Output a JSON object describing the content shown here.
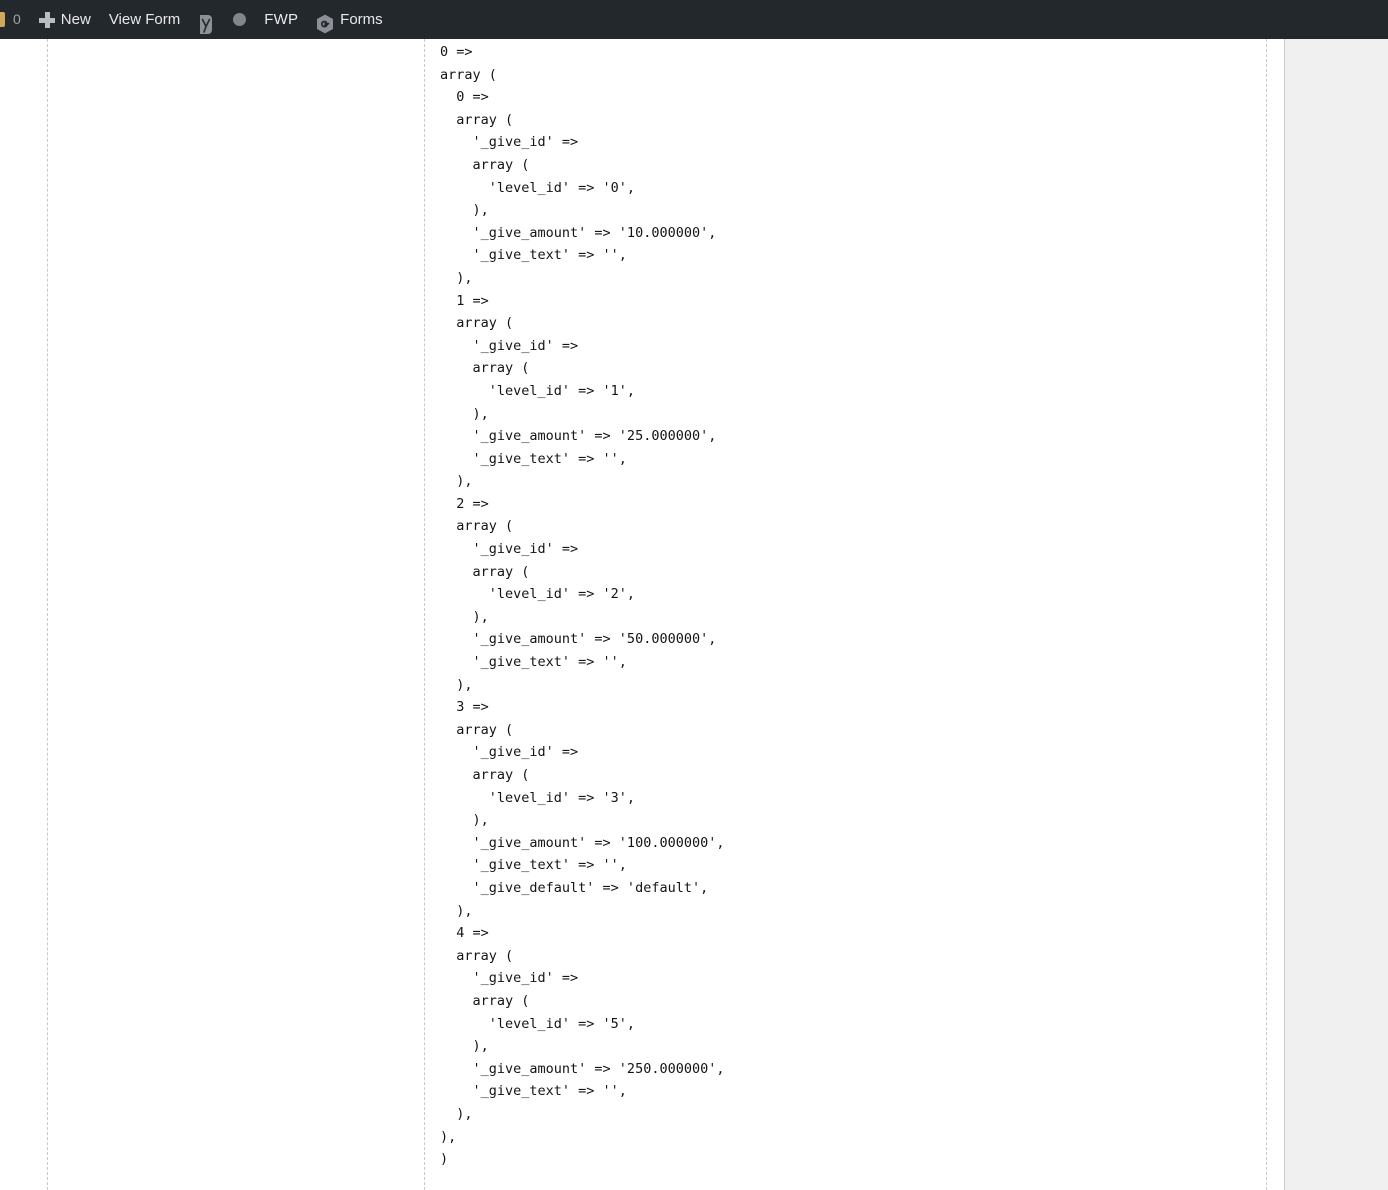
{
  "adminbar": {
    "background": "#23282d",
    "items": [
      {
        "name": "comment-bubble-icon",
        "icon": "comment-bubble-icon",
        "label": "",
        "count": "0"
      },
      {
        "name": "new-content",
        "icon": "plus-icon",
        "label": "New"
      },
      {
        "name": "view-form",
        "icon": "",
        "label": "View Form"
      },
      {
        "name": "yoast-seo",
        "icon": "yoast-icon",
        "label": ""
      },
      {
        "name": "circle-status",
        "icon": "circle-icon",
        "label": ""
      },
      {
        "name": "fwp",
        "icon": "",
        "label": "FWP"
      },
      {
        "name": "givewp-forms",
        "icon": "givewp-hexagon-icon",
        "label": "Forms"
      }
    ],
    "comment_count": "0",
    "new_label": "New",
    "view_form_label": "View Form",
    "fwp_label": "FWP",
    "forms_label": "Forms"
  },
  "code_dump": {
    "language": "php-var-export",
    "text": "0 => \narray (\n  0 => \n  array (\n    '_give_id' => \n    array (\n      'level_id' => '0',\n    ),\n    '_give_amount' => '10.000000',\n    '_give_text' => '',\n  ),\n  1 => \n  array (\n    '_give_id' => \n    array (\n      'level_id' => '1',\n    ),\n    '_give_amount' => '25.000000',\n    '_give_text' => '',\n  ),\n  2 => \n  array (\n    '_give_id' => \n    array (\n      'level_id' => '2',\n    ),\n    '_give_amount' => '50.000000',\n    '_give_text' => '',\n  ),\n  3 => \n  array (\n    '_give_id' => \n    array (\n      'level_id' => '3',\n    ),\n    '_give_amount' => '100.000000',\n    '_give_text' => '',\n    '_give_default' => 'default',\n  ),\n  4 => \n  array (\n    '_give_id' => \n    array (\n      'level_id' => '5',\n    ),\n    '_give_amount' => '250.000000',\n    '_give_text' => '',\n  ),\n),\n)",
    "levels": [
      {
        "index": "0",
        "level_id": "0",
        "give_amount": "10.000000",
        "give_text": "",
        "give_default": null
      },
      {
        "index": "1",
        "level_id": "1",
        "give_amount": "25.000000",
        "give_text": "",
        "give_default": null
      },
      {
        "index": "2",
        "level_id": "2",
        "give_amount": "50.000000",
        "give_text": "",
        "give_default": null
      },
      {
        "index": "3",
        "level_id": "3",
        "give_amount": "100.000000",
        "give_text": "",
        "give_default": "default"
      },
      {
        "index": "4",
        "level_id": "5",
        "give_amount": "250.000000",
        "give_text": "",
        "give_default": null
      }
    ]
  },
  "colors": {
    "adminbar_bg": "#23282d",
    "adminbar_text": "#e9e9ea",
    "page_bg": "#ffffff",
    "gutter_bg": "#f0f0f0",
    "code_text": "#141414",
    "guide_line": "#c8c8c8"
  }
}
